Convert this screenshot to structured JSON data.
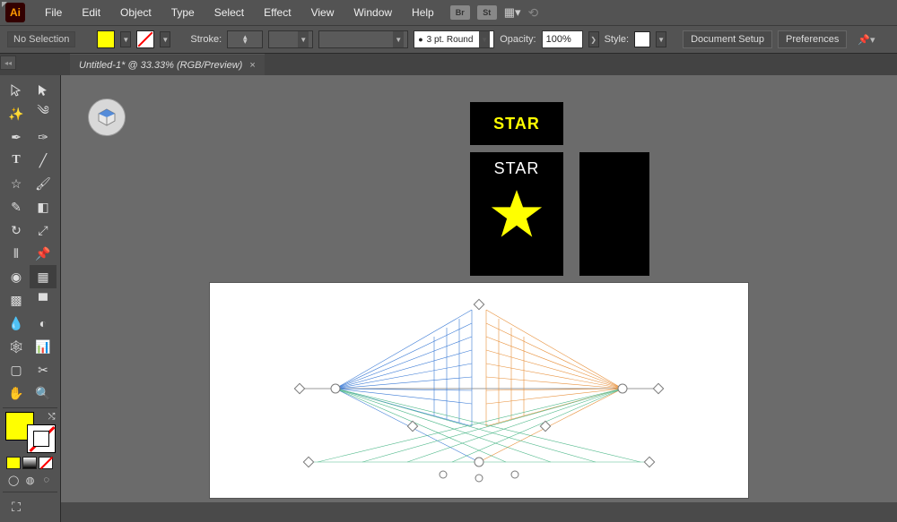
{
  "app": {
    "logo": "Ai"
  },
  "menu": {
    "items": [
      "File",
      "Edit",
      "Object",
      "Type",
      "Select",
      "Effect",
      "View",
      "Window",
      "Help"
    ],
    "bridge": "Br",
    "stock": "St"
  },
  "control": {
    "selection": "No Selection",
    "stroke_label": "Stroke:",
    "brush_label": "3 pt. Round",
    "opacity_label": "Opacity:",
    "opacity_value": "100%",
    "style_label": "Style:",
    "doc_setup": "Document Setup",
    "preferences": "Preferences"
  },
  "tab": {
    "title": "Untitled-1* @ 33.33% (RGB/Preview)",
    "close": "×"
  },
  "artboards": {
    "star_yellow": "STAR",
    "star_white": "STAR"
  },
  "colors": {
    "fill": "#ffff00",
    "stroke": "none",
    "accent_blue": "#3b7bd6",
    "accent_orange": "#e8913c",
    "accent_green": "#50b98b"
  },
  "tools": {
    "left": [
      "selection",
      "direct-selection",
      "magic-wand",
      "lasso",
      "pen",
      "curvature",
      "type",
      "line",
      "rectangle",
      "paintbrush",
      "shaper",
      "eraser",
      "rotate",
      "scale",
      "width",
      "free-transform",
      "shape-builder",
      "perspective-grid",
      "mesh",
      "gradient",
      "eyedropper",
      "blend",
      "symbol-sprayer",
      "column-graph",
      "artboard",
      "slice",
      "hand",
      "zoom"
    ],
    "perspective_selected": true
  }
}
